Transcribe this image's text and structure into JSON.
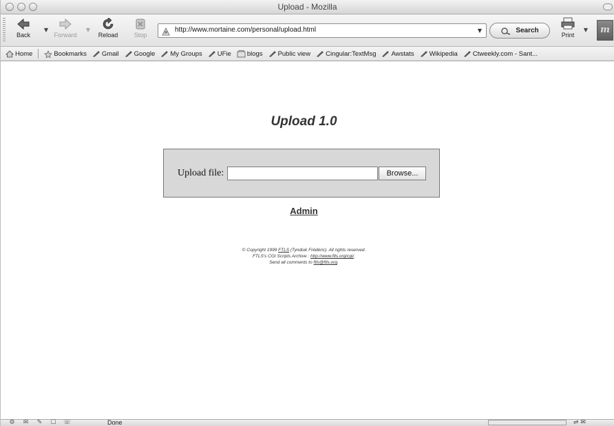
{
  "window": {
    "title": "Upload - Mozilla"
  },
  "nav": {
    "back": "Back",
    "forward": "Forward",
    "reload": "Reload",
    "stop": "Stop",
    "url": "http://www.mortaine.com/personal/upload.html",
    "search": "Search",
    "print": "Print"
  },
  "bookmarks": {
    "home": "Home",
    "bookmarks": "Bookmarks",
    "items": [
      "Gmail",
      "Google",
      "My Groups",
      "UFie",
      "blogs",
      "Public view",
      "Cingular:TextMsg",
      "Awstats",
      "Wikipedia",
      "Ctweekly.com - Sant..."
    ]
  },
  "page": {
    "heading": "Upload 1.0",
    "upload_label": "Upload file:",
    "file_value": "",
    "browse": "Browse...",
    "admin": "Admin",
    "footer": {
      "line1_a": "© Copyright 1999 ",
      "line1_link": "FTLS",
      "line1_b": " (Tyndiuk Frédéric). All rights reserved.",
      "line2_a": "FTLS's CGI Scripts Archive : ",
      "line2_link": "http://www.ftls.org/cgi/",
      "line2_b": ".",
      "line3_a": "Send all comments to ",
      "line3_link": "ftls@ftls.org",
      "line3_b": "."
    }
  },
  "status": {
    "text": "Done"
  },
  "colors": {
    "form_bg": "#d8d8d8",
    "text": "#333333"
  }
}
